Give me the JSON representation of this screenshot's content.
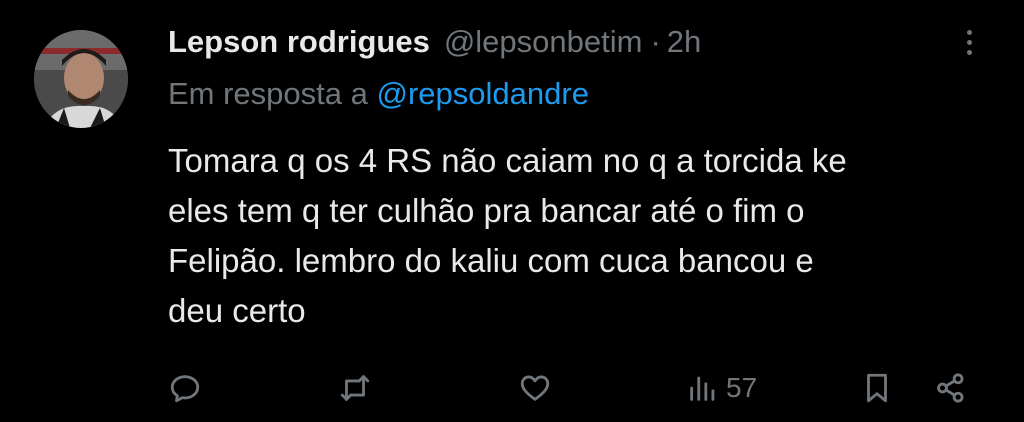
{
  "tweet": {
    "author_name": "Lepson rodrigues",
    "author_handle": "@lepsonbetim",
    "separator": "·",
    "time": "2h",
    "reply_prefix": "Em resposta a",
    "reply_to": "@repsoldandre",
    "lines": [
      "Tomara q os 4 RS não caiam no q a torcida ke",
      "eles tem q ter culhão pra bancar até o fim o",
      "Felipão. lembro do kaliu com cuca bancou e",
      "deu certo"
    ]
  },
  "actions": {
    "reply_icon": "reply-icon",
    "retweet_icon": "retweet-icon",
    "like_icon": "like-icon",
    "views_icon": "views-icon",
    "views_count": "57",
    "bookmark_icon": "bookmark-icon",
    "share_icon": "share-icon"
  },
  "colors": {
    "background": "#000000",
    "text": "#e7e9ea",
    "muted": "#71767b",
    "link": "#1d9bf0"
  }
}
